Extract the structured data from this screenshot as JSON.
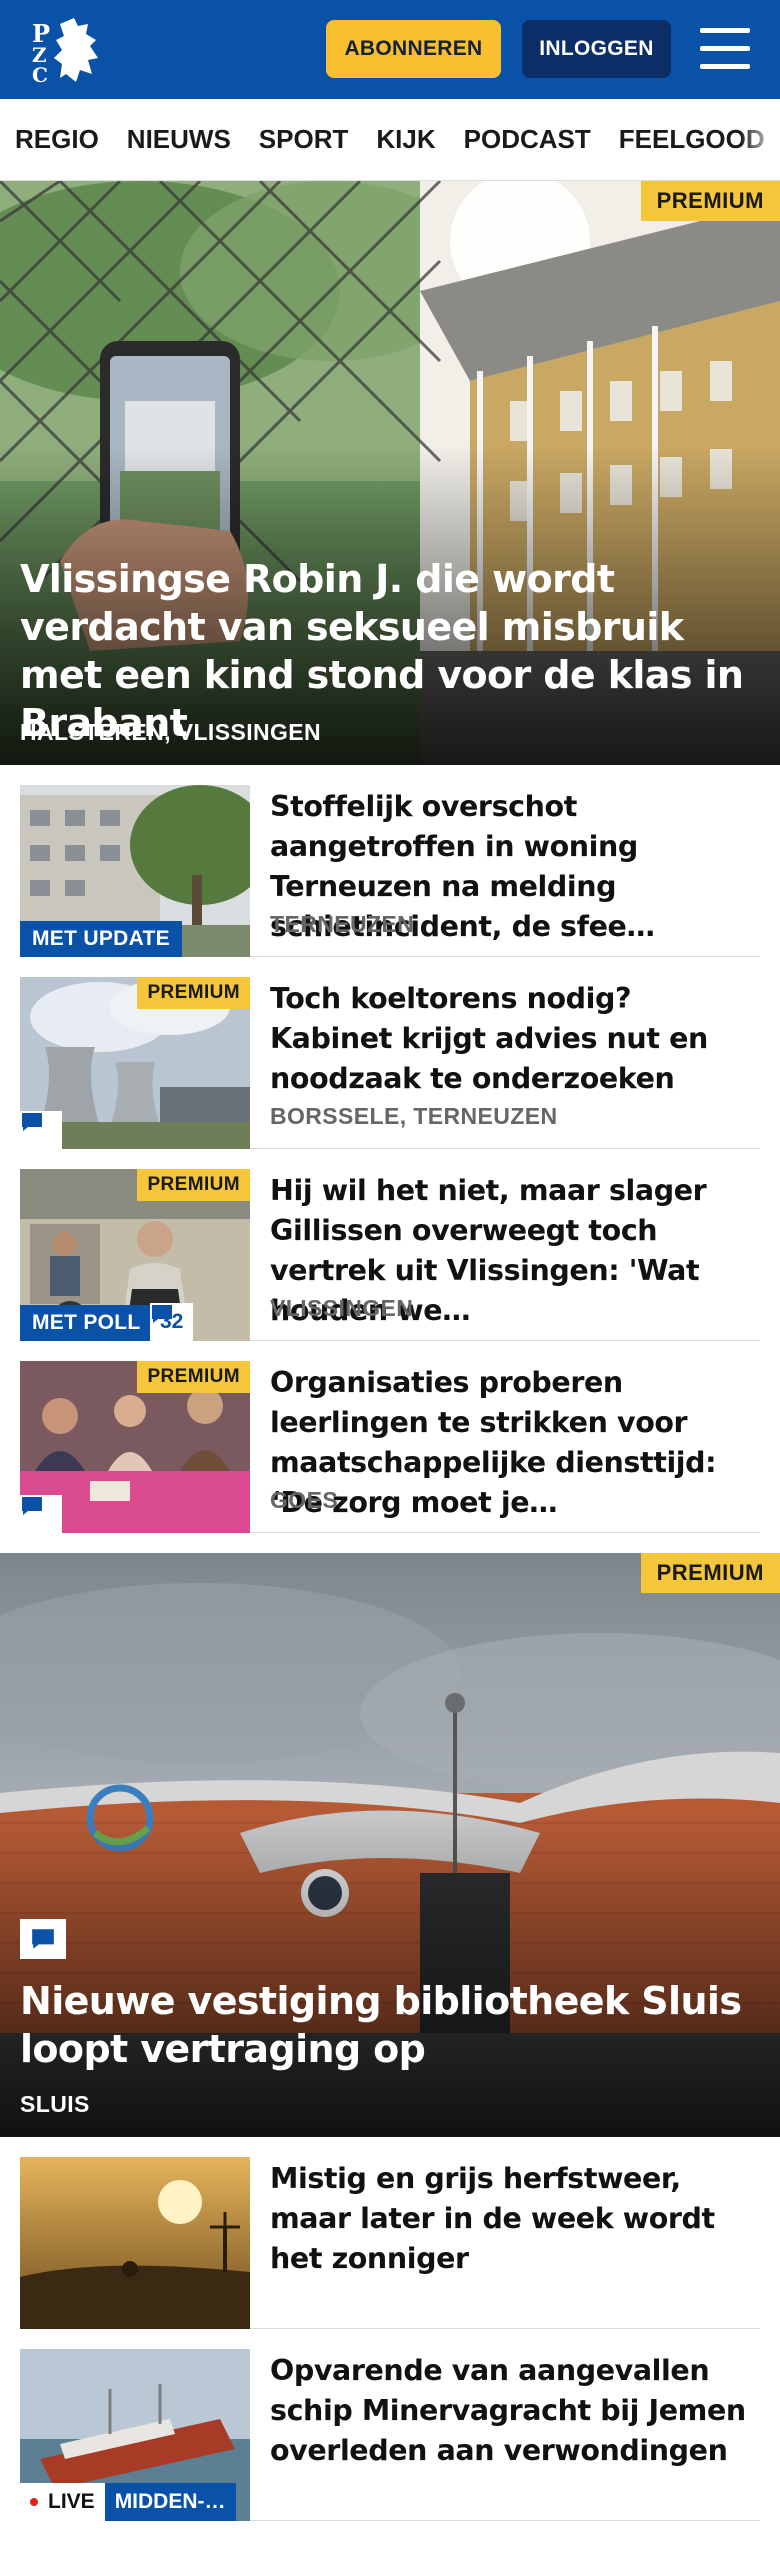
{
  "header": {
    "logo_text": "PZC",
    "subscribe_label": "ABONNEREN",
    "login_label": "INLOGGEN"
  },
  "nav": {
    "items": [
      "REGIO",
      "NIEUWS",
      "SPORT",
      "KIJK",
      "PODCAST",
      "FEELGOOD"
    ]
  },
  "hero1": {
    "premium": "PREMIUM",
    "title": "Vlissingse Robin J. die wordt verdacht van seksueel misbruik met een kind stond voor de klas in Brabant",
    "location": "HALSTEREN, VLISSINGEN"
  },
  "articles": [
    {
      "title": "Stoffelijk overschot aangetrof­fen in woning Terneuzen na melding schietincident, de sfee…",
      "location": "TERNEUZEN",
      "badge": "MET UPDATE"
    },
    {
      "title": "Toch koeltorens nodig? Kabinet krijgt advies nut en noodzaak te onderzoeken",
      "location": "BORSSELE, TERNEUZEN",
      "premium": "PREMIUM"
    },
    {
      "title": "Hij wil het niet, maar slager Gillissen overweegt toch vertrek uit Vlissingen: 'Wat houden we…",
      "location": "VLISSINGEN",
      "premium": "PREMIUM",
      "badge": "MET POLL",
      "comments": "32"
    },
    {
      "title": "Organisaties proberen leerlingen te strikken voor maatschappelij­ke diensttijd: ‘De zorg moet je…",
      "location": "GOES",
      "premium": "PREMIUM"
    }
  ],
  "hero2": {
    "premium": "PREMIUM",
    "title": "Nieuwe vestiging bibliotheek Sluis loopt vertraging op",
    "location": "SLUIS"
  },
  "articles2": [
    {
      "title": "Mistig en grijs herfstweer, maar later in de week wordt het zonniger"
    },
    {
      "title": "Opvarende van aangevallen schip Minervagracht bij Jemen overleden aan verwondingen",
      "live": "LIVE",
      "category": "MIDDEN-…"
    }
  ],
  "colors": {
    "brand_blue": "#0a52a8",
    "premium_yellow": "#f5c53a",
    "subscribe_yellow": "#f9bf2f",
    "login_navy": "#0b2e66"
  }
}
